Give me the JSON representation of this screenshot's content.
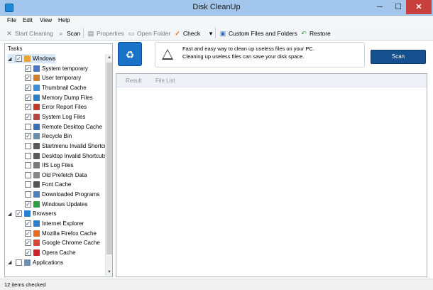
{
  "window": {
    "title": "Disk CleanUp",
    "min": "─",
    "max": "☐",
    "close": "✕"
  },
  "menu": [
    "File",
    "Edit",
    "View",
    "Help"
  ],
  "toolbar": {
    "start_cleaning": "Start Cleaning",
    "scan": "Scan",
    "properties": "Properties",
    "open_folder": "Open Folder",
    "check": "Check",
    "custom": "Custom Files and Folders",
    "restore": "Restore"
  },
  "tasks_header": "Tasks",
  "tree": [
    {
      "label": "Windows",
      "level": 0,
      "checked": true,
      "icon": "windows-icon",
      "color": "#e8a33a",
      "selected": true
    },
    {
      "label": "System temporary",
      "level": 1,
      "checked": true,
      "icon": "folder-icon",
      "color": "#4a78c2"
    },
    {
      "label": "User temporary",
      "level": 1,
      "checked": true,
      "icon": "user-icon",
      "color": "#d07f2a"
    },
    {
      "label": "Thumbnail Cache",
      "level": 1,
      "checked": true,
      "icon": "image-icon",
      "color": "#3b8ed8"
    },
    {
      "label": "Memory Dump Files",
      "level": 1,
      "checked": true,
      "icon": "memory-icon",
      "color": "#2d7fc1"
    },
    {
      "label": "Error Report Files",
      "level": 1,
      "checked": true,
      "icon": "error-icon",
      "color": "#c0392b"
    },
    {
      "label": "System Log Files",
      "level": 1,
      "checked": true,
      "icon": "log-icon",
      "color": "#b84545"
    },
    {
      "label": "Remote Desktop Cache",
      "level": 1,
      "checked": false,
      "icon": "remote-icon",
      "color": "#3a6fb5"
    },
    {
      "label": "Recycle Bin",
      "level": 1,
      "checked": true,
      "icon": "recycle-icon",
      "color": "#6a8fa8"
    },
    {
      "label": "Startmenu Invalid Shortcu",
      "level": 1,
      "checked": false,
      "icon": "shortcut-icon",
      "color": "#5a5a5a"
    },
    {
      "label": "Desktop Invalid Shortcuts",
      "level": 1,
      "checked": false,
      "icon": "shortcut-icon",
      "color": "#5a5a5a"
    },
    {
      "label": "IIS Log Files",
      "level": 1,
      "checked": false,
      "icon": "log-icon",
      "color": "#7a7a7a"
    },
    {
      "label": "Old Prefetch Data",
      "level": 1,
      "checked": false,
      "icon": "file-icon",
      "color": "#888888"
    },
    {
      "label": "Font Cache",
      "level": 1,
      "checked": false,
      "icon": "font-icon",
      "color": "#555555"
    },
    {
      "label": "Downloaded Programs",
      "level": 1,
      "checked": false,
      "icon": "download-icon",
      "color": "#4f7fbf"
    },
    {
      "label": "Windows Updates",
      "level": 1,
      "checked": true,
      "icon": "update-icon",
      "color": "#2f9e44"
    },
    {
      "label": "Browsers",
      "level": 0,
      "checked": true,
      "icon": "globe-icon",
      "color": "#2a7dd1"
    },
    {
      "label": "Internet Explorer",
      "level": 1,
      "checked": true,
      "icon": "ie-icon",
      "color": "#2a7dd1"
    },
    {
      "label": "Mozilla Firefox Cache",
      "level": 1,
      "checked": true,
      "icon": "firefox-icon",
      "color": "#e66b1f"
    },
    {
      "label": "Google Chrome Cache",
      "level": 1,
      "checked": true,
      "icon": "chrome-icon",
      "color": "#d9443a"
    },
    {
      "label": "Opera Cache",
      "level": 1,
      "checked": true,
      "icon": "opera-icon",
      "color": "#cc2229"
    },
    {
      "label": "Applications",
      "level": 0,
      "checked": false,
      "icon": "apps-icon",
      "color": "#6b8fb5"
    }
  ],
  "info": {
    "line1": "Fast and easy way to clean up useless files on your PC.",
    "line2": "Cleaning up useless files can save your disk space.",
    "scan_button": "Scan"
  },
  "tabs": [
    "Result",
    "File List"
  ],
  "status": "12 items checked"
}
